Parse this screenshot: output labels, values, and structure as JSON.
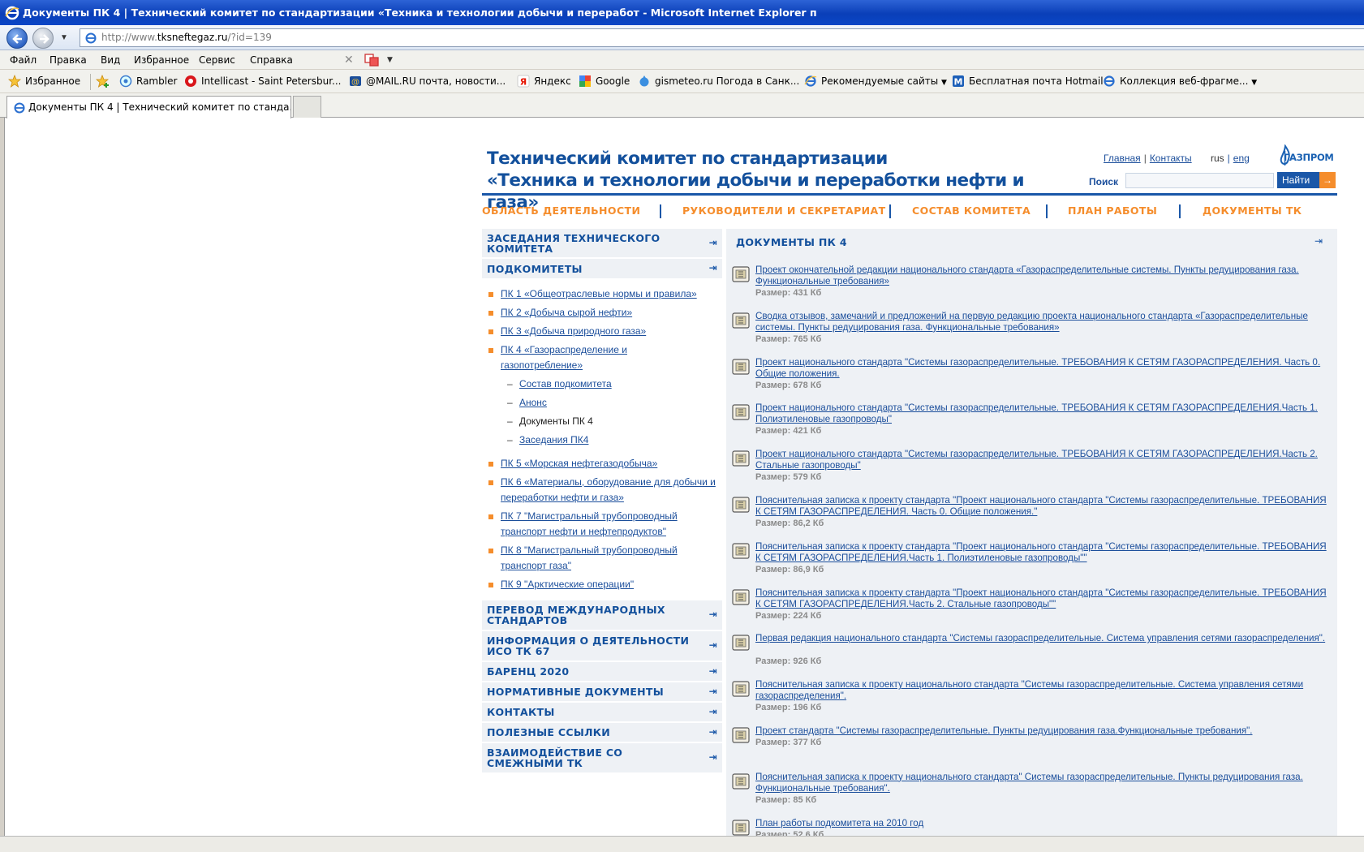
{
  "browser": {
    "window_title": "Документы ПК 4 | Технический комитет по стандартизации «Техника и технологии добычи и переработ - Microsoft Internet Explorer п",
    "url_prefix": "http://www.",
    "url_domain": "tksneftegaz.ru",
    "url_suffix": "/?id=139",
    "menu": [
      "Файл",
      "Правка",
      "Вид",
      "Избранное",
      "Сервис",
      "Справка"
    ],
    "favorites_label": "Избранное",
    "favorites": [
      {
        "label": "Rambler",
        "icon": "rambler-icon"
      },
      {
        "label": "Intellicast - Saint Petersbur...",
        "icon": "intellicast-icon"
      },
      {
        "label": "@MAIL.RU почта, новости...",
        "icon": "mailru-icon"
      },
      {
        "label": "Яндекс",
        "icon": "yandex-icon"
      },
      {
        "label": "Google",
        "icon": "google-icon"
      },
      {
        "label": "gismeteo.ru Погода в Санк...",
        "icon": "gismeteo-icon"
      },
      {
        "label": "Рекомендуемые сайты",
        "icon": "ie-icon"
      },
      {
        "label": "Бесплатная почта Hotmail",
        "icon": "msn-icon"
      },
      {
        "label": "Коллекция веб-фрагме...",
        "icon": "webslice-icon"
      }
    ],
    "tab_title": "Документы ПК 4 | Технический комитет по станда..."
  },
  "site": {
    "title_line1": "Технический комитет по стандартизации",
    "title_line2": "«Техника и технологии добычи и переработки нефти и газа»",
    "link_home": "Главная",
    "link_contacts": "Контакты",
    "lang_rus": "rus",
    "lang_eng": "eng",
    "logo_text": "ГАЗПРОМ",
    "search_label": "Поиск",
    "search_button": "Найти",
    "nav": [
      "ОБЛАСТЬ ДЕЯТЕЛЬНОСТИ",
      "РУКОВОДИТЕЛИ И СЕКРЕТАРИАТ",
      "СОСТАВ КОМИТЕТА",
      "ПЛАН РАБОТЫ",
      "ДОКУМЕНТЫ ТК"
    ]
  },
  "sidebar": {
    "sections_top": [
      "ЗАСЕДАНИЯ ТЕХНИЧЕСКОГО КОМИТЕТА",
      "ПОДКОМИТЕТЫ"
    ],
    "subcommittees": [
      "ПК 1 «Общеотраслевые нормы и правила»",
      "ПК 2 «Добыча сырой нефти»",
      "ПК 3 «Добыча природного газа»",
      "ПК 4 «Газораспределение и газопотребление»"
    ],
    "pk4_items": [
      "Состав подкомитета",
      "Анонс",
      "Документы ПК 4",
      "Заседания ПК4"
    ],
    "subcommittees_rest": [
      "ПК 5 «Морская нефтегазодобыча»",
      "ПК 6 «Материалы, оборудование для добычи и переработки нефти и газа»",
      "ПК 7 \"Магистральный трубопроводный транспорт нефти и нефтепродуктов\"",
      "ПК 8 \"Магистральный трубопроводный транспорт газа\"",
      "ПК 9 \"Арктические операции\""
    ],
    "sections_bottom": [
      "ПЕРЕВОД МЕЖДУНАРОДНЫХ СТАНДАРТОВ",
      "ИНФОРМАЦИЯ О ДЕЯТЕЛЬНОСТИ ИСО ТК 67",
      "БАРЕНЦ 2020",
      "НОРМАТИВНЫЕ ДОКУМЕНТЫ",
      "КОНТАКТЫ",
      "ПОЛЕЗНЫЕ ССЫЛКИ",
      "ВЗАИМОДЕЙСТВИЕ СО СМЕЖНЫМИ ТК"
    ]
  },
  "main": {
    "title": "ДОКУМЕНТЫ ПК 4",
    "documents": [
      {
        "title": "Проект окончательной редакции национального стандарта «Газораспределительные системы. Пункты редуцирования газа. Функциональные требования»",
        "size": "Размер: 431 Кб"
      },
      {
        "title": "Сводка отзывов, замечаний и предложений на первую редакцию проекта национального стандарта «Газораспределительные системы. Пункты редуцирования газа. Функциональные требования»",
        "size": "Размер: 765 Кб"
      },
      {
        "title": "Проект национального стандарта \"Системы газораспределительные. ТРЕБОВАНИЯ К СЕТЯМ ГАЗОРАСПРЕДЕЛЕНИЯ. Часть 0. Общие положения.",
        "size": "Размер: 678 Кб"
      },
      {
        "title": "Проект национального стандарта \"Системы газораспределительные. ТРЕБОВАНИЯ К СЕТЯМ ГАЗОРАСПРЕДЕЛЕНИЯ.Часть 1. Полиэтиленовые газопроводы\"",
        "size": "Размер: 421 Кб"
      },
      {
        "title": "Проект национального стандарта \"Системы газораспределительные. ТРЕБОВАНИЯ К СЕТЯМ ГАЗОРАСПРЕДЕЛЕНИЯ.Часть 2. Стальные газопроводы\"",
        "size": "Размер: 579 Кб"
      },
      {
        "title": "Пояснительная записка к проекту стандарта \"Проект национального стандарта \"Системы газораспределительные. ТРЕБОВАНИЯ К СЕТЯМ ГАЗОРАСПРЕДЕЛЕНИЯ. Часть 0. Общие положения.\"",
        "size": "Размер: 86,2 Кб"
      },
      {
        "title": "Пояснительная записка к проекту стандарта \"Проект национального стандарта \"Системы газораспределительные. ТРЕБОВАНИЯ К СЕТЯМ ГАЗОРАСПРЕДЕЛЕНИЯ.Часть 1. Полиэтиленовые газопроводы\"\"",
        "size": "Размер: 86,9 Кб"
      },
      {
        "title": "Пояснительная записка к проекту стандарта \"Проект национального стандарта \"Системы газораспределительные. ТРЕБОВАНИЯ К СЕТЯМ ГАЗОРАСПРЕДЕЛЕНИЯ.Часть 2. Стальные газопроводы\"\"",
        "size": "Размер: 224 Кб"
      },
      {
        "title": "Первая редакция национального стандарта \"Системы газораспределительные. Система управления сетями газораспределения\".",
        "size": "Размер: 926 Кб"
      },
      {
        "title": "Пояснительная записка к проекту национального стандарта \"Системы газораспределительные. Система управления сетями газораспределения\".",
        "size": "Размер: 196 Кб"
      },
      {
        "title": "Проект стандарта \"Системы газораспределительные. Пункты редуцирования газа.Функциональные требования\".",
        "size": "Размер: 377 Кб"
      },
      {
        "title": "Пояснительная записка к проекту национального стандарта\" Системы газораспределительные. Пункты редуцирования газа. Функциональные требования\".",
        "size": "Размер: 85 Кб"
      },
      {
        "title": "План работы подкомитета на 2010 год",
        "size": "Размер: 52,6 Кб"
      }
    ]
  },
  "colors": {
    "brand_blue": "#13509c",
    "accent_orange": "#f58d2c",
    "panel_bg": "#eef1f5"
  }
}
